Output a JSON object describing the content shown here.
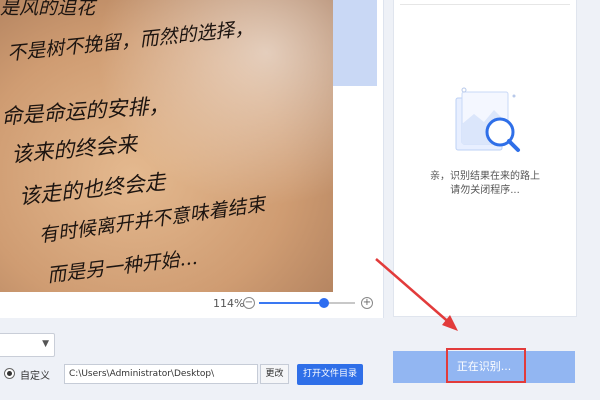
{
  "preview": {
    "zoom_label": "114%",
    "zoom_percent": 114,
    "zoom_slider_fraction": 0.68,
    "zoom_minus_symbol": "−",
    "zoom_plus_symbol": "+",
    "image_lines": [
      "是风的追花",
      "不是树不挽留，而然的选择，",
      "命是命运的安排，",
      "该来的终会来",
      "该走的也终会走",
      "有时候离开并不意味着结束",
      "而是另一种开始..."
    ]
  },
  "result": {
    "message_line1": "亲，识别结果在来的路上",
    "message_line2": "请勿关闭程序..."
  },
  "options": {
    "custom_label": "自定义",
    "path_value": "C:\\Users\\Administrator\\Desktop\\",
    "change_label": "更改",
    "open_dir_label": "打开文件目录"
  },
  "actions": {
    "recognize_label": "正在识别..."
  },
  "colors": {
    "accent": "#2f6fe8",
    "recognize_bg": "#92b6f2",
    "annotation_red": "#e23b3b"
  },
  "icons": {
    "zoom_out": "zoom-out-icon",
    "zoom_in": "zoom-in-icon",
    "dropdown": "chevron-down-icon",
    "search_illustration": "magnifier-icon"
  }
}
